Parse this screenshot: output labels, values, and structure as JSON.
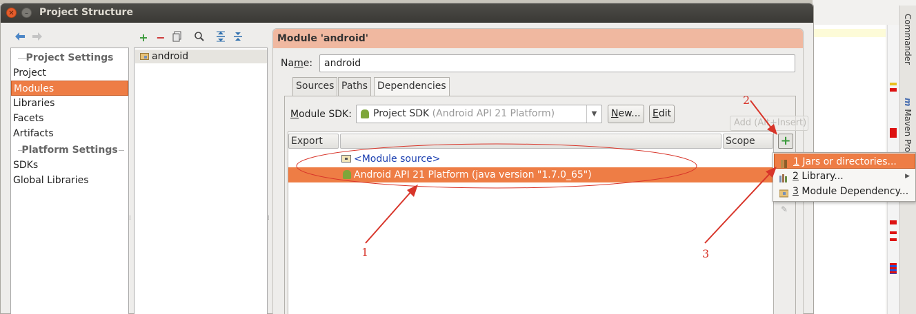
{
  "window": {
    "title": "Project Structure"
  },
  "toolbar": {
    "back": "back-arrow-icon",
    "forward": "forward-arrow-icon",
    "add": "plus-icon",
    "remove": "minus-icon",
    "copy": "copy-icon",
    "find": "magnifier-icon",
    "expand": "expand-all-icon",
    "collapse": "collapse-all-icon"
  },
  "sidebar": {
    "project_settings_header": "Project Settings",
    "project_items": [
      {
        "label": "Project"
      },
      {
        "label": "Modules",
        "selected": true
      },
      {
        "label": "Libraries"
      },
      {
        "label": "Facets"
      },
      {
        "label": "Artifacts"
      }
    ],
    "platform_settings_header": "Platform Settings",
    "platform_items": [
      {
        "label": "SDKs"
      },
      {
        "label": "Global Libraries"
      }
    ]
  },
  "module_tree": {
    "items": [
      {
        "label": "android",
        "icon": "module-folder-icon"
      }
    ]
  },
  "module": {
    "header": "Module 'android'",
    "name_label_pre": "Na",
    "name_label_mn": "m",
    "name_label_post": "e:",
    "name_value": "android",
    "tabs": [
      {
        "label": "Sources"
      },
      {
        "label": "Paths"
      },
      {
        "label": "Dependencies",
        "active": true
      }
    ],
    "sdk_label_mn": "M",
    "sdk_label_rest": "odule SDK:",
    "sdk_value": "Project SDK",
    "sdk_hint": "(Android API 21 Platform)",
    "new_button_pre": "N",
    "new_button_post": "ew...",
    "edit_button_pre": "E",
    "edit_button_post": "dit"
  },
  "dependencies": {
    "columns": {
      "export": "Export",
      "name": "",
      "scope": "Scope"
    },
    "rows": [
      {
        "label": "<Module source>",
        "icon": "module-source-icon"
      },
      {
        "label": "Android API 21 Platform (java version \"1.7.0_65\")",
        "icon": "android-icon",
        "selected": true
      }
    ],
    "add_tooltip": "Add (Alt+Insert)"
  },
  "popup_menu": {
    "items": [
      {
        "num": "1",
        "label": " Jars or directories...",
        "icon": "jar-icon",
        "selected": true
      },
      {
        "num": "2",
        "label": " Library...",
        "icon": "library-icon",
        "submenu": true
      },
      {
        "num": "3",
        "label": " Module Dependency...",
        "icon": "module-icon"
      }
    ]
  },
  "ide_side_tabs": {
    "commander": "Commander",
    "maven": "Maven Proj"
  },
  "annotations": {
    "n1": "1",
    "n2": "2",
    "n3": "3"
  },
  "colors": {
    "selection": "#ee7d45",
    "header": "#f0b8a0",
    "annotation": "#d8352a",
    "titlebar": "#3c3b37"
  }
}
